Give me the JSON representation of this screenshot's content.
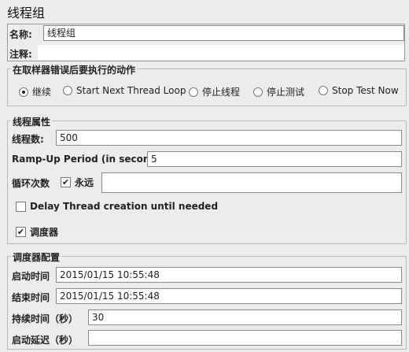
{
  "title": "线程组",
  "name_label": "名称:",
  "name_value": "线程组",
  "comment_label": "注释:",
  "error_action": {
    "legend": "在取样器错误后要执行的动作",
    "options": [
      "继续",
      "Start Next Thread Loop",
      "停止线程",
      "停止测试",
      "Stop Test Now"
    ],
    "selected": "继续"
  },
  "thread_props": {
    "legend": "线程属性",
    "threads_label": "线程数:",
    "threads_value": "500",
    "rampup_label": "Ramp-Up Period (in seconds):",
    "rampup_value": "5",
    "loop_label": "循环次数",
    "forever_label": "永远",
    "forever_checked": true,
    "delay_label": "Delay Thread creation until needed",
    "delay_checked": false,
    "scheduler_label": "调度器",
    "scheduler_checked": true
  },
  "scheduler": {
    "legend": "调度器配置",
    "start_label": "启动时间",
    "start_value": "2015/01/15 10:55:48",
    "end_label": "结束时间",
    "end_value": "2015/01/15 10:55:48",
    "duration_label": "持续时间（秒）",
    "duration_value": "30",
    "delay_label": "启动延迟（秒）",
    "delay_value": ""
  }
}
